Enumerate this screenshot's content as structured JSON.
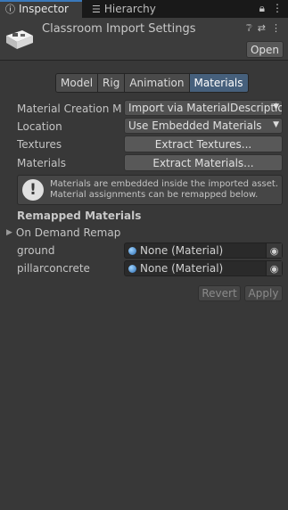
{
  "tabs": {
    "inspector": "Inspector",
    "hierarchy": "Hierarchy"
  },
  "icons": {
    "inspector": "info-icon",
    "hierarchy": "list-icon",
    "lock": "lock-icon",
    "menu": "kebab-menu-icon",
    "help": "help-icon",
    "presets": "sliders-icon",
    "more": "more-icon"
  },
  "header": {
    "title": "Classroom Import Settings",
    "open_label": "Open"
  },
  "toolbar": {
    "tabs": [
      "Model",
      "Rig",
      "Animation",
      "Materials"
    ],
    "selected": "Materials"
  },
  "fields": {
    "material_creation_mode_label": "Material Creation Mo",
    "material_creation_mode_value": "Import via MaterialDescriptio",
    "location_label": "Location",
    "location_value": "Use Embedded Materials",
    "textures_label": "Textures",
    "extract_textures_label": "Extract Textures...",
    "materials_label": "Materials",
    "extract_materials_label": "Extract Materials..."
  },
  "info": {
    "line1": "Materials are embedded inside the imported asset.",
    "line2": "Material assignments can be remapped below."
  },
  "remapped": {
    "title": "Remapped Materials",
    "on_demand_label": "On Demand Remap",
    "items": [
      {
        "name": "ground",
        "value": "None (Material)"
      },
      {
        "name": "pillarconcrete",
        "value": "None (Material)"
      }
    ]
  },
  "actions": {
    "revert_label": "Revert",
    "apply_label": "Apply"
  },
  "colors": {
    "background": "#383838",
    "selected_tab": "#46607c",
    "accent": "#3a79bb"
  }
}
